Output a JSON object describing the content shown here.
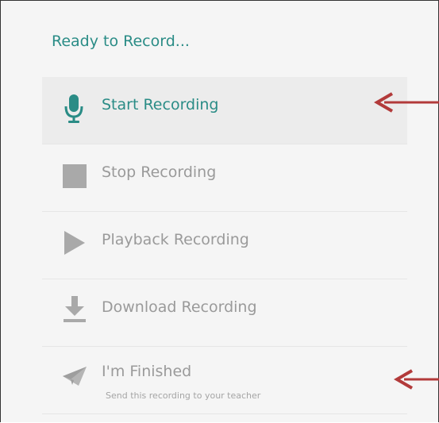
{
  "status": "Ready to Record...",
  "items": [
    {
      "label": "Start Recording",
      "icon": "microphone-icon",
      "state": "active"
    },
    {
      "label": "Stop Recording",
      "icon": "stop-square-icon",
      "state": "disabled"
    },
    {
      "label": "Playback Recording",
      "icon": "play-icon",
      "state": "disabled"
    },
    {
      "label": "Download Recording",
      "icon": "download-icon",
      "state": "disabled"
    },
    {
      "label": "I'm Finished",
      "sublabel": "Send this recording to your teacher",
      "icon": "send-paper-plane-icon",
      "state": "disabled"
    }
  ],
  "colors": {
    "accent": "#2a8c86",
    "disabled": "#9a9a9a",
    "annotation_arrow": "#b23a3a"
  },
  "annotations": [
    "red-arrow-pointing-to-start-recording",
    "red-arrow-pointing-to-im-finished"
  ]
}
